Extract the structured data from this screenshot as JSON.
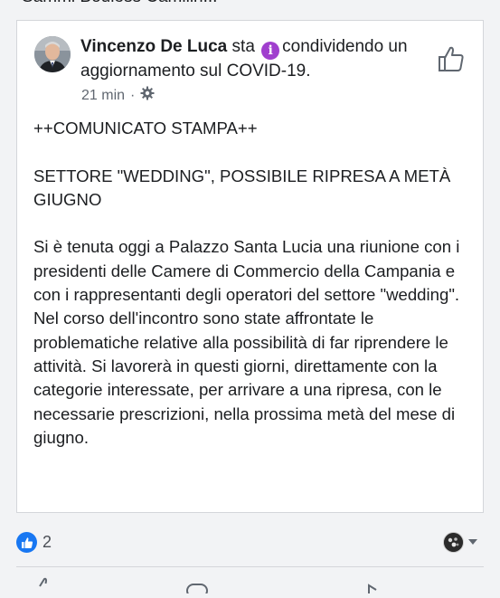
{
  "top_fragment": "Sammi Bouless Camilin...",
  "post": {
    "author": "Vincenzo De Luca",
    "header_mid": " sta ",
    "status_text": "condividendo un aggiornamento sul COVID-19.",
    "time": "21 min",
    "dot": "·",
    "title": "++COMUNICATO STAMPA++",
    "subtitle": "SETTORE \"WEDDING\", POSSIBILE RIPRESA A METÀ GIUGNO",
    "body": "Si è tenuta oggi a Palazzo Santa Lucia una riunione con i presidenti delle Camere di Commercio della Campania e con i rappresentanti degli operatori del settore \"wedding\". Nel corso dell'incontro sono state affrontate le problematiche relative alla possibilità di far riprendere le attività. Si lavorerà in questi giorni, direttamente con la categorie interessate, per arrivare a una ripresa, con le necessarie prescrizioni, nella prossima metà del mese di giugno."
  },
  "reactions": {
    "count": "2",
    "reaction_icon": "thumbs-up-icon"
  },
  "icons": {
    "status": "info-icon",
    "privacy": "gear-icon",
    "like": "thumbs-up-outline-icon",
    "viewer": "avatar",
    "dropdown": "chevron-down-icon"
  },
  "colors": {
    "accent": "#1877f2",
    "status_icon": "#a03fce",
    "meta_text": "#606770"
  }
}
